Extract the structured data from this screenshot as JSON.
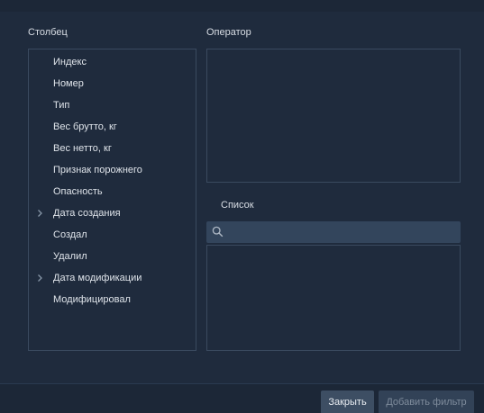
{
  "columns_section": {
    "title": "Столбец",
    "items": [
      {
        "label": "Индекс",
        "expandable": false
      },
      {
        "label": "Номер",
        "expandable": false
      },
      {
        "label": "Тип",
        "expandable": false
      },
      {
        "label": "Вес брутто, кг",
        "expandable": false
      },
      {
        "label": "Вес нетто, кг",
        "expandable": false
      },
      {
        "label": "Признак порожнего",
        "expandable": false
      },
      {
        "label": "Опасность",
        "expandable": false
      },
      {
        "label": "Дата создания",
        "expandable": true
      },
      {
        "label": "Создал",
        "expandable": false
      },
      {
        "label": "Удалил",
        "expandable": false
      },
      {
        "label": "Дата модификации",
        "expandable": true
      },
      {
        "label": "Модифицировал",
        "expandable": false
      }
    ]
  },
  "operator_section": {
    "title": "Оператор"
  },
  "list_section": {
    "title": "Список",
    "search_placeholder": "",
    "search_icon": "search-icon"
  },
  "footer": {
    "close_label": "Закрыть",
    "add_filter_label": "Добавить фильтр"
  },
  "colors": {
    "background": "#1f2b3d",
    "panel_border": "#3a4a5f",
    "search_bg": "#33455c",
    "button_close_bg": "#3d4e63",
    "button_add_bg": "#324257",
    "text": "#dfe4ea",
    "disabled_text": "#7f8c9c"
  }
}
